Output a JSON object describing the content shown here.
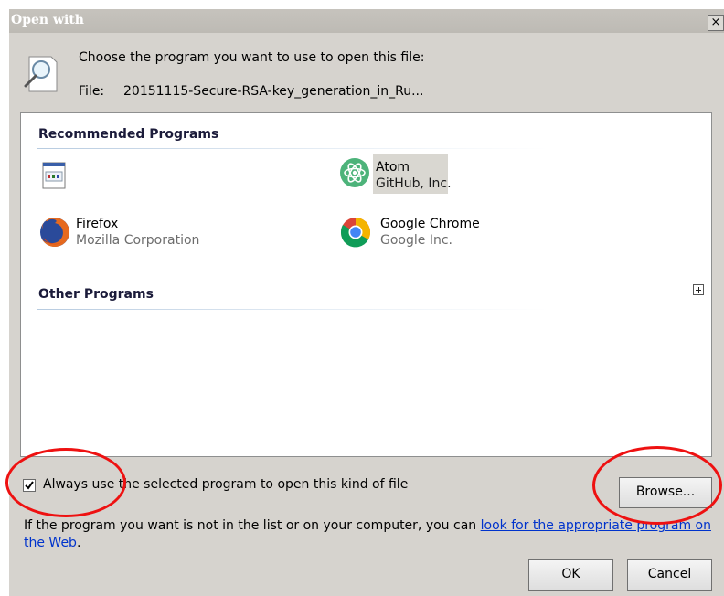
{
  "window": {
    "title": "Open with",
    "close_glyph": "×"
  },
  "header": {
    "prompt": "Choose the program you want to use to open this file:",
    "file_label": "File:",
    "file_name": "20151115-Secure-RSA-key_generation_in_Ru..."
  },
  "recommended": {
    "header": "Recommended Programs",
    "programs": [
      {
        "name": "",
        "vendor": "",
        "icon": "generic-app-icon"
      },
      {
        "name": "Atom",
        "vendor": "GitHub, Inc.",
        "icon": "atom-icon"
      },
      {
        "name": "Firefox",
        "vendor": "Mozilla Corporation",
        "icon": "firefox-icon"
      },
      {
        "name": "Google Chrome",
        "vendor": "Google Inc.",
        "icon": "chrome-icon"
      }
    ]
  },
  "other": {
    "header": "Other Programs",
    "expand_icon": "plus-box-icon"
  },
  "always_use": {
    "checked": true,
    "label": "Always use the selected program to open this kind of file"
  },
  "browse_label": "Browse...",
  "info": {
    "text": "If the program you want is not in the list or on your computer, you can ",
    "link": "look for the appropriate program on the Web",
    "suffix": "."
  },
  "buttons": {
    "ok": "OK",
    "cancel": "Cancel"
  },
  "colors": {
    "annotation": "#ee1111",
    "link": "#0033cc",
    "dialog_bg": "#d6d3ce"
  }
}
